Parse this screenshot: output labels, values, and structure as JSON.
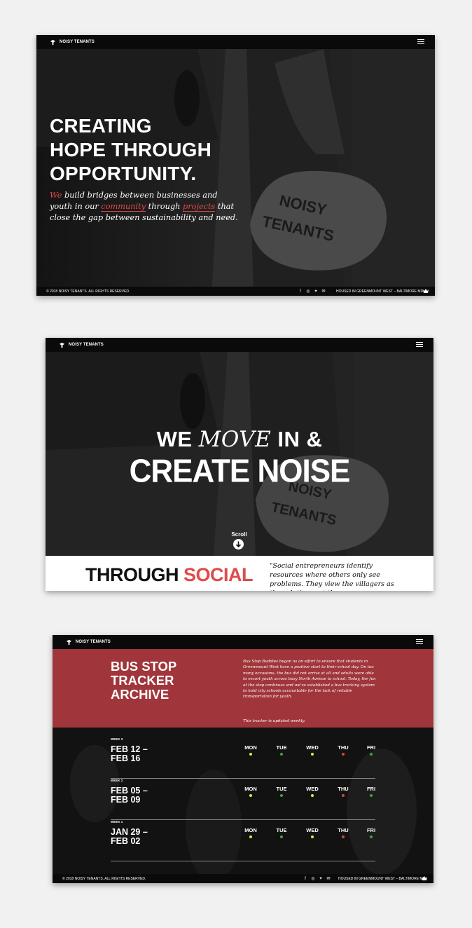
{
  "brand": {
    "name": "NOISY TENANTS"
  },
  "colors": {
    "accent": "#e04a4a",
    "panel_red": "#a0363b",
    "dot_yellow": "#e8e24a",
    "dot_green": "#46a047",
    "dot_red": "#d44545"
  },
  "hero": {
    "title_lines": [
      "CREATING",
      "HOPE THROUGH",
      "OPPORTUNITY."
    ],
    "sub": {
      "we": "We",
      "t1": " build bridges between businesses and youth in our ",
      "community": "community",
      "t2": " through ",
      "projects": "projects",
      "t3": " that close the gap between sustainability and need."
    }
  },
  "footer": {
    "copyright": "© 2018 NOISY TENANTS. ALL RIGHTS RESERVED.",
    "housed": "HOUSED IN GREENMOUNT WEST – BALTIMORE MD",
    "social_icons": [
      "facebook-icon",
      "instagram-icon",
      "twitter-icon",
      "mail-icon"
    ]
  },
  "move": {
    "we": "WE ",
    "move": "MOVE",
    "in": " IN &",
    "noise": "CREATE NOISE",
    "scroll": "Scroll",
    "through": "THROUGH ",
    "social": "SOCIAL",
    "quote": "\"Social entrepreneurs identify resources where others only see problems. They view the villagers as the solution, not the"
  },
  "tracker": {
    "title_lines": [
      "BUS STOP",
      "TRACKER",
      "ARCHIVE"
    ],
    "description": "Bus Stop Buddies began as an effort to ensure that students in Greenmount West have a positive start to their school day. On too many occasions, the bus did not arrive at all and adults were able to escort youth across busy North Avenue to school. Today, the fun at the stop continues and we've established a bus tracking system to hold city schools accountable for the lack of reliable transportation for youth.",
    "note": "This tracker is updated weekly.",
    "day_labels": [
      "MON",
      "TUE",
      "WED",
      "THU",
      "FRI"
    ],
    "weeks": [
      {
        "label": "WEEK 3",
        "start": "FEB 12 –",
        "end": "FEB 16",
        "status": [
          "yellow",
          "green",
          "yellow",
          "red",
          "green"
        ]
      },
      {
        "label": "WEEK 2",
        "start": "FEB 05 –",
        "end": "FEB 09",
        "status": [
          "yellow",
          "green",
          "yellow",
          "red",
          "green"
        ]
      },
      {
        "label": "WEEK 1",
        "start": "JAN 29 –",
        "end": "FEB 02",
        "status": [
          "yellow",
          "green",
          "yellow",
          "red",
          "green"
        ]
      }
    ]
  }
}
